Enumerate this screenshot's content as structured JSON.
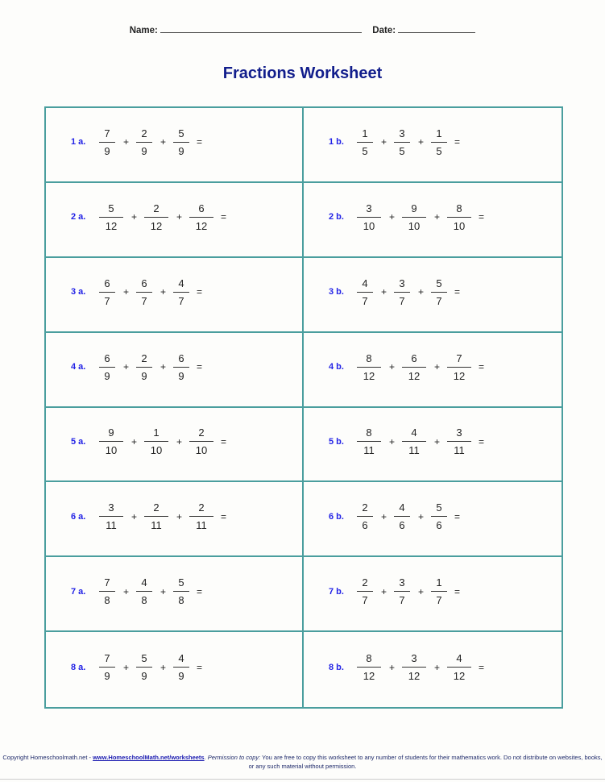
{
  "header": {
    "name_label": "Name:",
    "date_label": "Date:"
  },
  "title": "Fractions Worksheet",
  "problems": [
    {
      "label": "1 a.",
      "fractions": [
        {
          "n": "7",
          "d": "9"
        },
        {
          "n": "2",
          "d": "9"
        },
        {
          "n": "5",
          "d": "9"
        }
      ]
    },
    {
      "label": "1 b.",
      "fractions": [
        {
          "n": "1",
          "d": "5"
        },
        {
          "n": "3",
          "d": "5"
        },
        {
          "n": "1",
          "d": "5"
        }
      ]
    },
    {
      "label": "2 a.",
      "fractions": [
        {
          "n": "5",
          "d": "12"
        },
        {
          "n": "2",
          "d": "12"
        },
        {
          "n": "6",
          "d": "12"
        }
      ]
    },
    {
      "label": "2 b.",
      "fractions": [
        {
          "n": "3",
          "d": "10"
        },
        {
          "n": "9",
          "d": "10"
        },
        {
          "n": "8",
          "d": "10"
        }
      ]
    },
    {
      "label": "3 a.",
      "fractions": [
        {
          "n": "6",
          "d": "7"
        },
        {
          "n": "6",
          "d": "7"
        },
        {
          "n": "4",
          "d": "7"
        }
      ]
    },
    {
      "label": "3 b.",
      "fractions": [
        {
          "n": "4",
          "d": "7"
        },
        {
          "n": "3",
          "d": "7"
        },
        {
          "n": "5",
          "d": "7"
        }
      ]
    },
    {
      "label": "4 a.",
      "fractions": [
        {
          "n": "6",
          "d": "9"
        },
        {
          "n": "2",
          "d": "9"
        },
        {
          "n": "6",
          "d": "9"
        }
      ]
    },
    {
      "label": "4 b.",
      "fractions": [
        {
          "n": "8",
          "d": "12"
        },
        {
          "n": "6",
          "d": "12"
        },
        {
          "n": "7",
          "d": "12"
        }
      ]
    },
    {
      "label": "5 a.",
      "fractions": [
        {
          "n": "9",
          "d": "10"
        },
        {
          "n": "1",
          "d": "10"
        },
        {
          "n": "2",
          "d": "10"
        }
      ]
    },
    {
      "label": "5 b.",
      "fractions": [
        {
          "n": "8",
          "d": "11"
        },
        {
          "n": "4",
          "d": "11"
        },
        {
          "n": "3",
          "d": "11"
        }
      ]
    },
    {
      "label": "6 a.",
      "fractions": [
        {
          "n": "3",
          "d": "11"
        },
        {
          "n": "2",
          "d": "11"
        },
        {
          "n": "2",
          "d": "11"
        }
      ]
    },
    {
      "label": "6 b.",
      "fractions": [
        {
          "n": "2",
          "d": "6"
        },
        {
          "n": "4",
          "d": "6"
        },
        {
          "n": "5",
          "d": "6"
        }
      ]
    },
    {
      "label": "7 a.",
      "fractions": [
        {
          "n": "7",
          "d": "8"
        },
        {
          "n": "4",
          "d": "8"
        },
        {
          "n": "5",
          "d": "8"
        }
      ]
    },
    {
      "label": "7 b.",
      "fractions": [
        {
          "n": "2",
          "d": "7"
        },
        {
          "n": "3",
          "d": "7"
        },
        {
          "n": "1",
          "d": "7"
        }
      ]
    },
    {
      "label": "8 a.",
      "fractions": [
        {
          "n": "7",
          "d": "9"
        },
        {
          "n": "5",
          "d": "9"
        },
        {
          "n": "4",
          "d": "9"
        }
      ]
    },
    {
      "label": "8 b.",
      "fractions": [
        {
          "n": "8",
          "d": "12"
        },
        {
          "n": "3",
          "d": "12"
        },
        {
          "n": "4",
          "d": "12"
        }
      ]
    }
  ],
  "operator": "+",
  "equals": "=",
  "footer": {
    "copyright": "Copyright Homeschoolmath.net - ",
    "link": "www.HomeschoolMath.net/worksheets",
    "after_link": ".  ",
    "permission_label": "Permission to copy:",
    "permission_text": " You are free to copy this worksheet to any number of students for their mathematics work. Do not distribute on websites, books, or any such material without permission."
  }
}
